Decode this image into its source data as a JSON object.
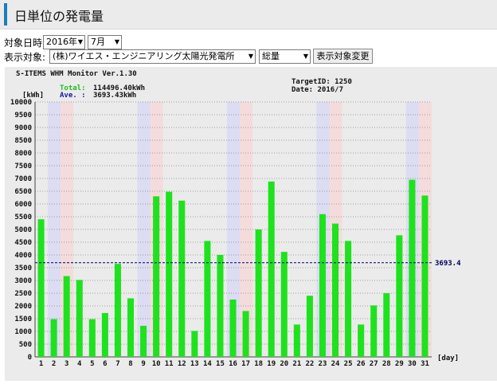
{
  "header": {
    "title": "日単位の発電量"
  },
  "filters": {
    "date_label": "対象日時:",
    "year": "2016年",
    "month": "7月",
    "target_label": "表示対象:",
    "target": "(株)ワイエス・エンジニアリング太陽光発電所",
    "measure": "総量",
    "change_button": "表示対象変更"
  },
  "chart_info": {
    "monitor": "S-ITEMS WHM Monitor Ver.1.30",
    "total_label": "Total:",
    "total_value": "114496.40kWh",
    "ave_label": "Ave. :",
    "ave_value": "3693.43kWh",
    "target_id": "TargetID: 1250",
    "date": "Date: 2016/7",
    "avg_line_label": "3693.4"
  },
  "colors": {
    "bar": "#1ee21e",
    "saturday_band": "#dcdcf2",
    "sunday_band": "#f4dcdc",
    "avg_line": "#000060"
  },
  "chart_data": {
    "type": "bar",
    "title": "S-ITEMS WHM Monitor Ver.1.30",
    "xlabel": "[day]",
    "ylabel": "[kWh]",
    "ylim": [
      0,
      10000
    ],
    "yticks": [
      0,
      500,
      1000,
      1500,
      2000,
      2500,
      3000,
      3500,
      4000,
      4500,
      5000,
      5500,
      6000,
      6500,
      7000,
      7500,
      8000,
      8500,
      9000,
      9500,
      10000
    ],
    "categories": [
      "1",
      "2",
      "3",
      "4",
      "5",
      "6",
      "7",
      "8",
      "9",
      "10",
      "11",
      "12",
      "13",
      "14",
      "15",
      "16",
      "17",
      "18",
      "19",
      "20",
      "21",
      "22",
      "23",
      "24",
      "25",
      "26",
      "27",
      "28",
      "29",
      "30",
      "31"
    ],
    "values": [
      5400,
      1480,
      3170,
      3020,
      1480,
      1720,
      3650,
      2300,
      1220,
      6300,
      6480,
      6130,
      1020,
      4550,
      4000,
      2250,
      1800,
      5000,
      6880,
      4120,
      1270,
      2400,
      5600,
      5230,
      4550,
      1270,
      2020,
      2500,
      4770,
      6950,
      6330
    ],
    "saturday_days": [
      "2",
      "9",
      "16",
      "23",
      "30"
    ],
    "sunday_days": [
      "3",
      "10",
      "17",
      "24",
      "31"
    ],
    "average": 3693.4,
    "grid": true
  }
}
